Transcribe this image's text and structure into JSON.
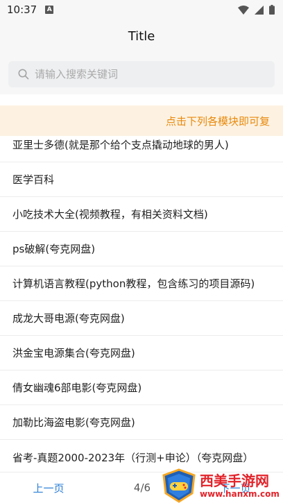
{
  "status": {
    "time": "10:37",
    "notif_letter": "A"
  },
  "app_bar": {
    "title": "Title"
  },
  "search": {
    "placeholder": "请输入搜索关键词"
  },
  "notice": {
    "text": "点击下列各模块即可复"
  },
  "list": [
    "亚里士多德(就是那个给个支点撬动地球的男人)",
    "医学百科",
    "小吃技术大全(视频教程，有相关资料文档)",
    "ps破解(夸克网盘)",
    "计算机语言教程(python教程，包含练习的项目源码)",
    "成龙大哥电源(夸克网盘)",
    "洪金宝电源集合(夸克网盘)",
    "倩女幽魂6部电影(夸克网盘)",
    "加勒比海盗电影(夸克网盘)",
    "省考-真题2000-2023年（行测+申论）（夸克网盘）"
  ],
  "pagination": {
    "prev": "上一页",
    "indicator": "4/6",
    "next": "下一页"
  },
  "watermark": {
    "title": "西美手游网",
    "url": "www.hanxm.com"
  },
  "colors": {
    "accent": "#2b7fd6",
    "notice_bg": "#fdf2e2",
    "notice_text": "#e8890c",
    "watermark": "#e2232a"
  }
}
